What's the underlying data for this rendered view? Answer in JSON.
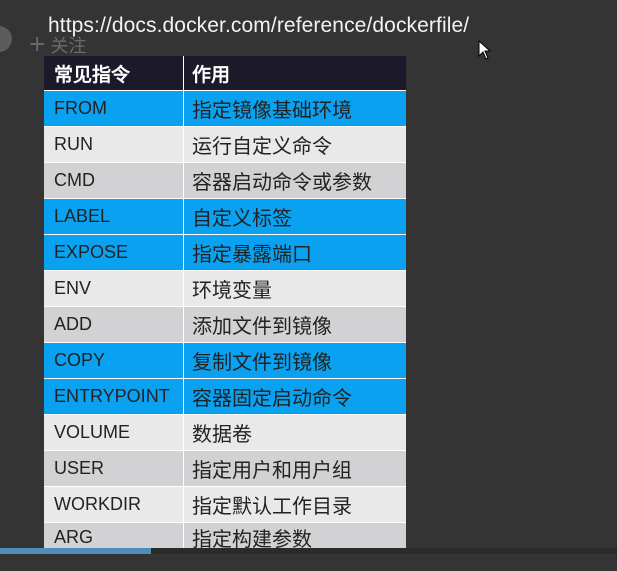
{
  "url": "https://docs.docker.com/reference/dockerfile/",
  "follow_label": "关注",
  "table": {
    "headers": [
      "常见指令",
      "作用"
    ],
    "rows": [
      {
        "cmd": "FROM",
        "desc": "指定镜像基础环境",
        "style": "blue"
      },
      {
        "cmd": "RUN",
        "desc": "运行自定义命令",
        "style": "white"
      },
      {
        "cmd": "CMD",
        "desc": "容器启动命令或参数",
        "style": "gray"
      },
      {
        "cmd": "LABEL",
        "desc": "自定义标签",
        "style": "blue"
      },
      {
        "cmd": "EXPOSE",
        "desc": "指定暴露端口",
        "style": "blue"
      },
      {
        "cmd": "ENV",
        "desc": "环境变量",
        "style": "white"
      },
      {
        "cmd": "ADD",
        "desc": "添加文件到镜像",
        "style": "gray"
      },
      {
        "cmd": "COPY",
        "desc": "复制文件到镜像",
        "style": "blue"
      },
      {
        "cmd": "ENTRYPOINT",
        "desc": "容器固定启动命令",
        "style": "blue"
      },
      {
        "cmd": "VOLUME",
        "desc": "数据卷",
        "style": "white"
      },
      {
        "cmd": "USER",
        "desc": "指定用户和用户组",
        "style": "gray"
      },
      {
        "cmd": "WORKDIR",
        "desc": "指定默认工作目录",
        "style": "white"
      },
      {
        "cmd": "ARG",
        "desc": "指定构建参数",
        "style": "gray"
      }
    ]
  },
  "video_progress_fraction": 0.245,
  "colors": {
    "blue_row": "#0aa2f0",
    "header": "#1c1a2a",
    "background": "#343434"
  }
}
